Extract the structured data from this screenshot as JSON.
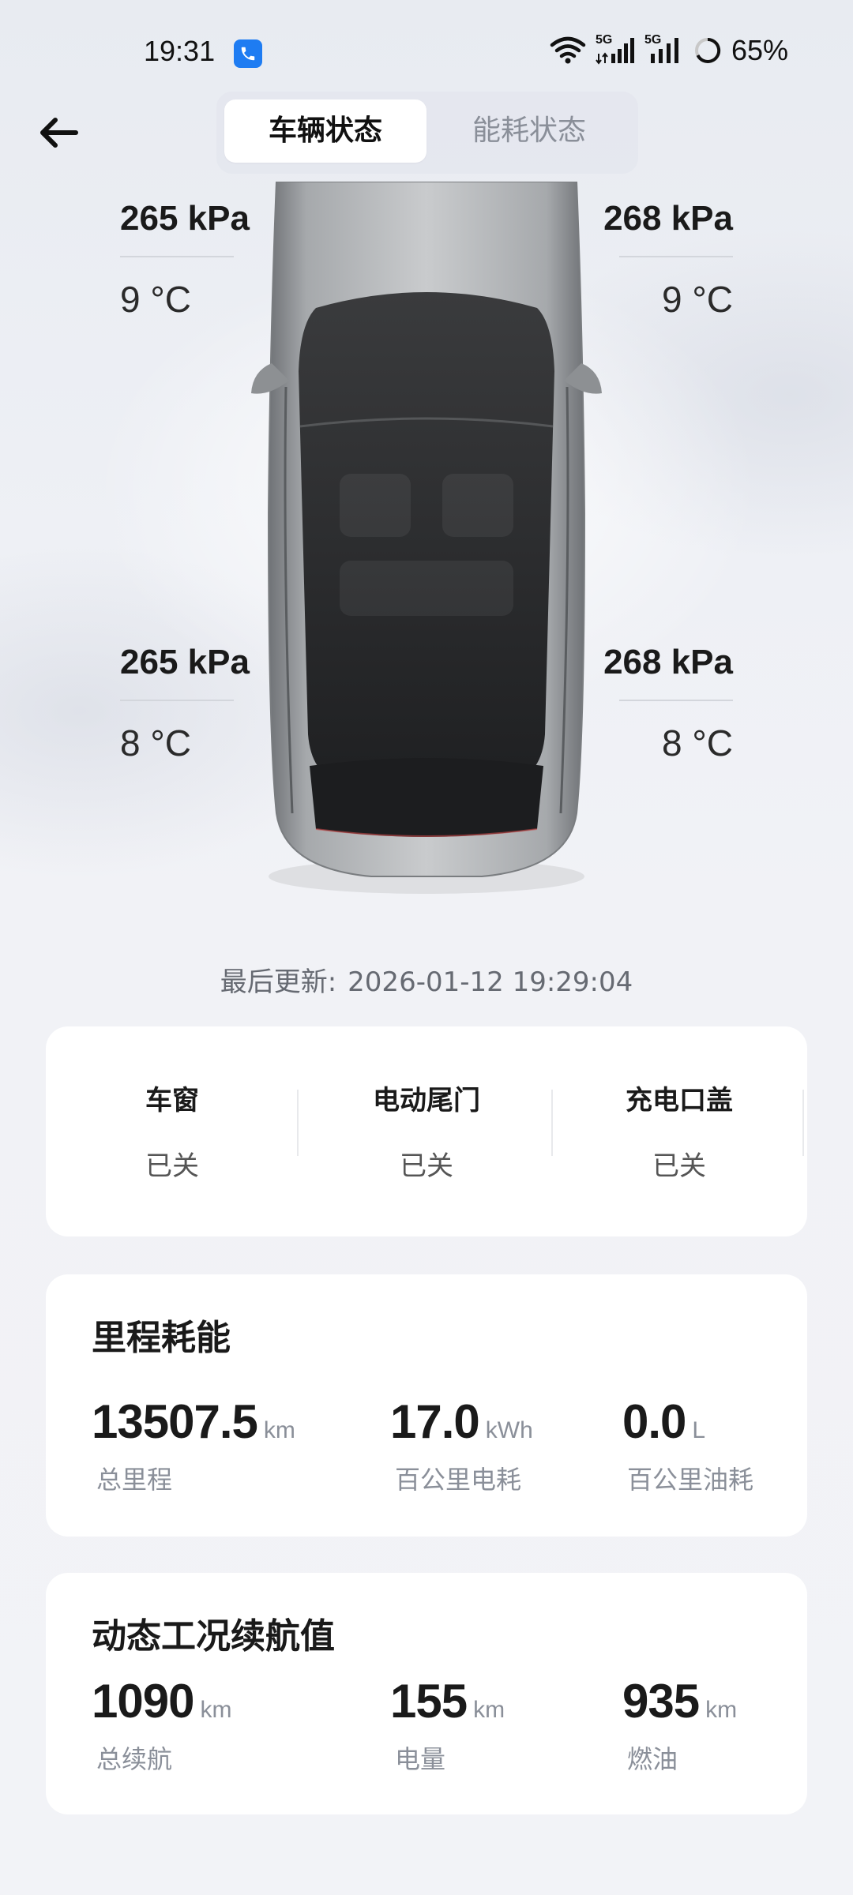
{
  "status_bar": {
    "time": "19:31",
    "battery": "65%",
    "signal1": "5G",
    "signal2": "5G"
  },
  "header": {
    "tabs": [
      "车辆状态",
      "能耗状态"
    ],
    "active_tab": "车辆状态"
  },
  "tires": {
    "front_left": {
      "pressure": "265 kPa",
      "temp": "9 °C"
    },
    "front_right": {
      "pressure": "268 kPa",
      "temp": "9 °C"
    },
    "rear_left": {
      "pressure": "265 kPa",
      "temp": "8 °C"
    },
    "rear_right": {
      "pressure": "268 kPa",
      "temp": "8 °C"
    }
  },
  "last_update": {
    "label": "最后更新:",
    "value": "2026-01-12 19:29:04"
  },
  "status_card": [
    {
      "label": "车窗",
      "value": "已关"
    },
    {
      "label": "电动尾门",
      "value": "已关"
    },
    {
      "label": "充电口盖",
      "value": "已关"
    }
  ],
  "energy_card": {
    "title": "里程耗能",
    "metrics": [
      {
        "value": "13507.5",
        "unit": "km",
        "label": "总里程"
      },
      {
        "value": "17.0",
        "unit": "kWh",
        "label": "百公里电耗"
      },
      {
        "value": "0.0",
        "unit": "L",
        "label": "百公里油耗"
      }
    ]
  },
  "range_card": {
    "title": "动态工况续航值",
    "metrics": [
      {
        "value": "1090",
        "unit": "km",
        "label": "总续航"
      },
      {
        "value": "155",
        "unit": "km",
        "label": "电量"
      },
      {
        "value": "935",
        "unit": "km",
        "label": "燃油"
      }
    ]
  },
  "colors": {
    "accent_call": "#1e7cf2",
    "card_bg": "#ffffff"
  }
}
